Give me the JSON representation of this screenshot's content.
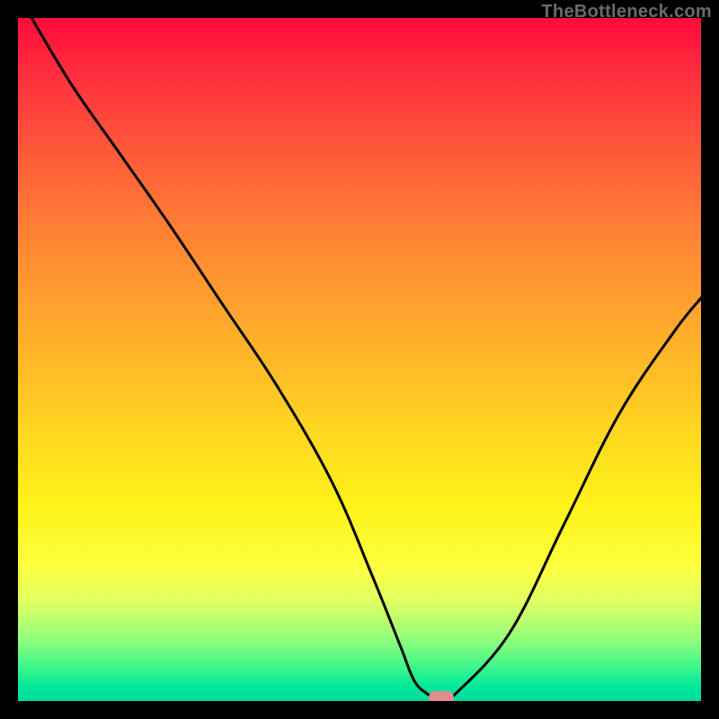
{
  "watermark": "TheBottleneck.com",
  "chart_data": {
    "type": "line",
    "title": "",
    "xlabel": "",
    "ylabel": "",
    "xlim": [
      0,
      100
    ],
    "ylim": [
      0,
      100
    ],
    "grid": false,
    "legend": false,
    "x": [
      2,
      8,
      15,
      22,
      30,
      38,
      46,
      52,
      56,
      58,
      60,
      62,
      64,
      72,
      80,
      88,
      96,
      100
    ],
    "values": [
      100,
      90,
      80,
      70,
      58,
      46,
      32,
      18,
      8,
      3,
      1,
      0,
      1,
      10,
      26,
      42,
      54,
      59
    ],
    "marker_x": 62,
    "marker_y": 0
  }
}
